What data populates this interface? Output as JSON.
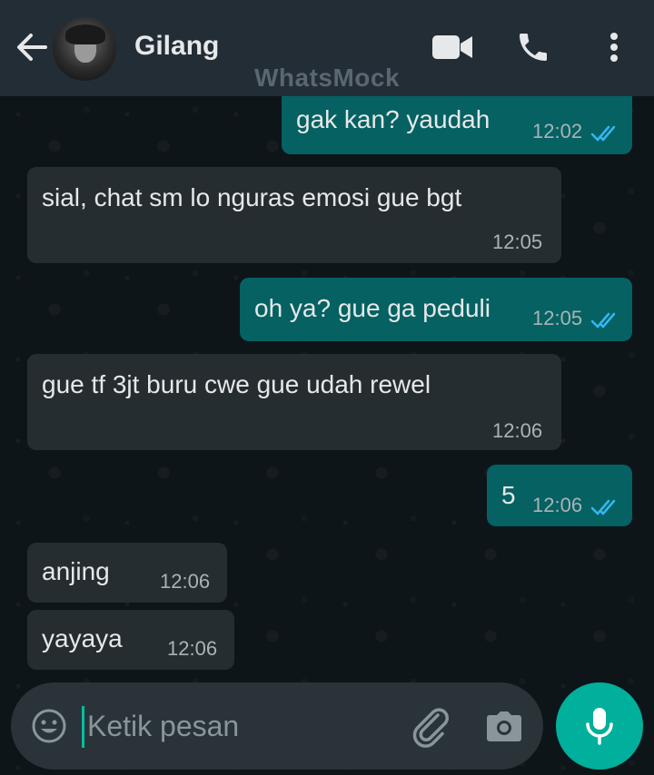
{
  "header": {
    "contact_name": "Gilang",
    "watermark": "WhatsMock",
    "icons": [
      "back-arrow-icon",
      "avatar",
      "video-call-icon",
      "phone-icon",
      "more-options-icon"
    ]
  },
  "messages": [
    {
      "direction": "out",
      "text": "gak kan? yaudah",
      "time": "12:02",
      "status": "read"
    },
    {
      "direction": "in",
      "text": "sial, chat sm lo nguras emosi gue bgt",
      "time": "12:05"
    },
    {
      "direction": "out",
      "text": "oh ya? gue ga peduli",
      "time": "12:05",
      "status": "read"
    },
    {
      "direction": "in",
      "text": "gue tf 3jt buru cwe gue udah rewel",
      "time": "12:06"
    },
    {
      "direction": "out",
      "text": "5",
      "time": "12:06",
      "status": "read"
    },
    {
      "direction": "in",
      "text": "anjing",
      "time": "12:06"
    },
    {
      "direction": "in",
      "text": "yayaya",
      "time": "12:06"
    }
  ],
  "composer": {
    "placeholder": "Ketik pesan"
  },
  "colors": {
    "header_bg": "#232d36",
    "chat_bg": "#0d1418",
    "incoming_bubble": "#262d31",
    "outgoing_bubble": "#056162",
    "read_ticks": "#34b7f1",
    "mic_button": "#00af9c"
  }
}
